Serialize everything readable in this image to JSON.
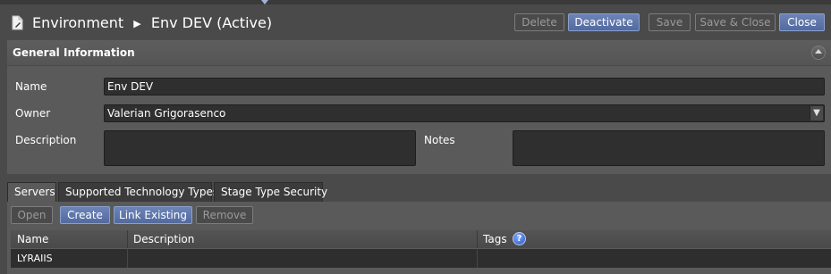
{
  "header": {
    "breadcrumb_root": "Environment",
    "breadcrumb_separator": "▶",
    "title": "Env DEV (Active)",
    "icon": "document-edit-icon"
  },
  "toolbar": {
    "delete_label": "Delete",
    "deactivate_label": "Deactivate",
    "save_label": "Save",
    "save_close_label": "Save & Close",
    "close_label": "Close"
  },
  "general": {
    "title": "General Information",
    "name_label": "Name",
    "name_value": "Env DEV",
    "owner_label": "Owner",
    "owner_value": "Valerian Grigorasenco",
    "description_label": "Description",
    "description_value": "",
    "notes_label": "Notes",
    "notes_value": ""
  },
  "tabs": [
    "Servers",
    "Supported Technology Types",
    "Stage Type Security"
  ],
  "servers": {
    "open_label": "Open",
    "create_label": "Create",
    "link_existing_label": "Link Existing",
    "remove_label": "Remove",
    "columns": [
      "Name",
      "Description",
      "Tags"
    ],
    "rows": [
      {
        "name": "LYRAIIS",
        "description": "",
        "tags": ""
      }
    ]
  },
  "colors": {
    "primary_button": "#5f78ae",
    "background": "#4a4a4a",
    "panel": "#5a5a5a",
    "input": "#2f2f2f"
  }
}
